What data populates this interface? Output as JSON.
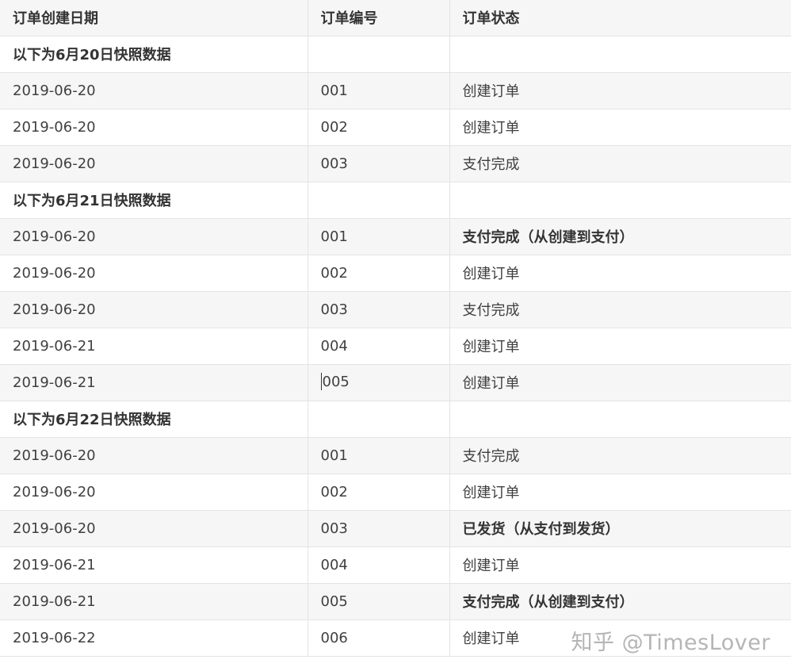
{
  "table": {
    "headers": [
      "订单创建日期",
      "订单编号",
      "订单状态"
    ],
    "rows": [
      {
        "cells": [
          "以下为6月20日快照数据",
          "",
          ""
        ],
        "bold": [
          true,
          false,
          false
        ]
      },
      {
        "cells": [
          "2019-06-20",
          "001",
          "创建订单"
        ],
        "bold": [
          false,
          false,
          false
        ]
      },
      {
        "cells": [
          "2019-06-20",
          "002",
          "创建订单"
        ],
        "bold": [
          false,
          false,
          false
        ]
      },
      {
        "cells": [
          "2019-06-20",
          "003",
          "支付完成"
        ],
        "bold": [
          false,
          false,
          false
        ]
      },
      {
        "cells": [
          "以下为6月21日快照数据",
          "",
          ""
        ],
        "bold": [
          true,
          false,
          false
        ]
      },
      {
        "cells": [
          "2019-06-20",
          "001",
          "支付完成（从创建到支付）"
        ],
        "bold": [
          false,
          false,
          true
        ]
      },
      {
        "cells": [
          "2019-06-20",
          "002",
          "创建订单"
        ],
        "bold": [
          false,
          false,
          false
        ]
      },
      {
        "cells": [
          "2019-06-20",
          "003",
          "支付完成"
        ],
        "bold": [
          false,
          false,
          false
        ]
      },
      {
        "cells": [
          "2019-06-21",
          "004",
          "创建订单"
        ],
        "bold": [
          false,
          false,
          false
        ]
      },
      {
        "cells": [
          "2019-06-21",
          "005",
          "创建订单"
        ],
        "bold": [
          false,
          false,
          false
        ],
        "caret_col": 1
      },
      {
        "cells": [
          "以下为6月22日快照数据",
          "",
          ""
        ],
        "bold": [
          true,
          false,
          false
        ]
      },
      {
        "cells": [
          "2019-06-20",
          "001",
          "支付完成"
        ],
        "bold": [
          false,
          false,
          false
        ]
      },
      {
        "cells": [
          "2019-06-20",
          "002",
          "创建订单"
        ],
        "bold": [
          false,
          false,
          false
        ]
      },
      {
        "cells": [
          "2019-06-20",
          "003",
          "已发货（从支付到发货）"
        ],
        "bold": [
          false,
          false,
          true
        ]
      },
      {
        "cells": [
          "2019-06-21",
          "004",
          "创建订单"
        ],
        "bold": [
          false,
          false,
          false
        ]
      },
      {
        "cells": [
          "2019-06-21",
          "005",
          "支付完成（从创建到支付）"
        ],
        "bold": [
          false,
          false,
          true
        ]
      },
      {
        "cells": [
          "2019-06-22",
          "006",
          "创建订单"
        ],
        "bold": [
          false,
          false,
          false
        ]
      }
    ]
  },
  "watermark": "知乎 @TimesLover",
  "colors": {
    "header_bg": "#f6f6f6",
    "stripe_bg": "#f6f6f6",
    "border": "#e4e4e4",
    "text": "#404040"
  }
}
